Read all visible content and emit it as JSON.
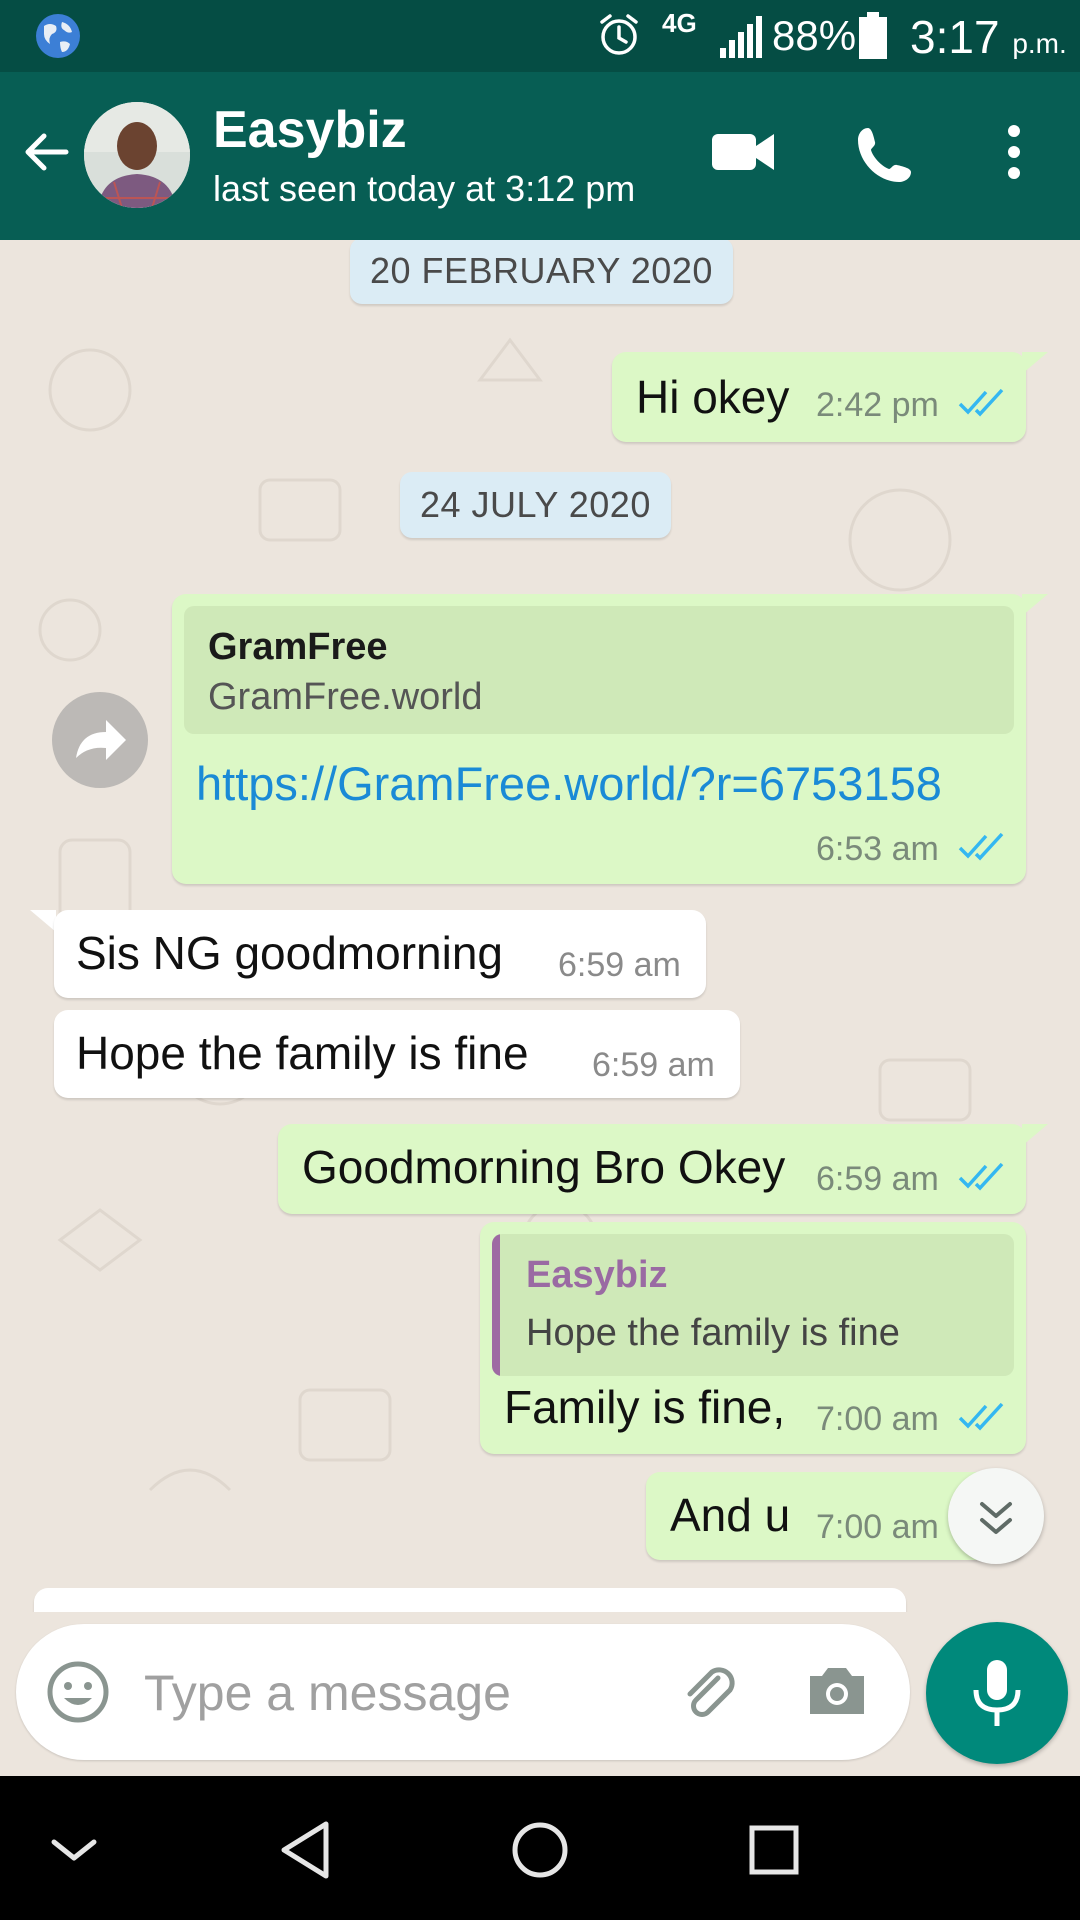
{
  "status_bar": {
    "network": "4G",
    "battery": "88%",
    "time": "3:17",
    "ampm": "p.m."
  },
  "header": {
    "contact_name": "Easybiz",
    "last_seen": "last seen today at 3:12 pm"
  },
  "messages": {
    "date1": "20 FEBRUARY 2020",
    "m1": {
      "text": "Hi okey",
      "time": "2:42 pm"
    },
    "date2": "24 JULY 2020",
    "m2": {
      "preview_title": "GramFree",
      "preview_site": "GramFree.world",
      "link": "https://GramFree.world/?r=6753158",
      "time": "6:53 am"
    },
    "m3": {
      "text": "Sis NG goodmorning",
      "time": "6:59 am"
    },
    "m4": {
      "text": "Hope the family is fine",
      "time": "6:59 am"
    },
    "m5": {
      "text": "Goodmorning Bro Okey",
      "time": "6:59 am"
    },
    "m6": {
      "quote_name": "Easybiz",
      "quote_text": "Hope the family is fine",
      "text": "Family is fine,",
      "time": "7:00 am"
    },
    "m7": {
      "text": "And u",
      "time": "7:00 am"
    }
  },
  "composer": {
    "placeholder": "Type a message"
  },
  "colors": {
    "header": "#075e54",
    "status_bar": "#054d44",
    "outgoing_bubble": "#dcf8c6",
    "incoming_bubble": "#ffffff",
    "read_ticks": "#34b7f1",
    "mic_button": "#00897b"
  }
}
